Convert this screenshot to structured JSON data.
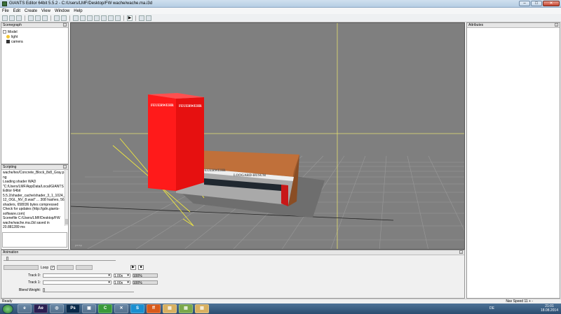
{
  "window": {
    "title": "GIANTS Editor 64bit 5.5.2 - C:/Users/LMF/Desktop/FW wache/wache.ma.i3d",
    "min": "–",
    "max": "□",
    "close": "✕"
  },
  "menu": [
    "File",
    "Edit",
    "Create",
    "View",
    "Window",
    "Help"
  ],
  "scenegraph": {
    "title": "Scenegraph",
    "nodes": [
      {
        "label": "Model",
        "icon": "expand-box"
      },
      {
        "label": "light",
        "icon": "bulb"
      },
      {
        "label": "camera",
        "icon": "camera"
      }
    ]
  },
  "scripting": {
    "title": "Scripting",
    "log": [
      "wache/tex/Concrete_Block_8x8_Gray.p",
      "ng",
      "Loading shader WAD",
      "\"C:/Users/LMF/AppData/Local/GIANTS",
      "Editor 64bit",
      "5.5.2/shader_cache/shader_3_1_1024_5",
      "12_OGL_NV_8.wad\" ... 308 hashes, 562",
      "shaders, 658036 bytes compressed",
      "Check for updates (http://gdn.giants-",
      "software.com)",
      "Scenefile C:/Users/LMF/Desktop/FW",
      "wache/wache.ma.i3d saved in",
      "20.881289 ms"
    ]
  },
  "viewport": {
    "camera_label": "persp",
    "building_tower_text": [
      "FEUERWEHR",
      "FEUERWEHR"
    ],
    "building_front_text": [
      "FREIWILLIGE FEUERWEHR",
      "LOOGARD-HUSUM"
    ]
  },
  "attributes": {
    "title": "Attributes"
  },
  "animation": {
    "title": "Animation",
    "loop_label": "Loop",
    "track0_label": "Track 0:",
    "track1_label": "Track 1:",
    "speed0": "1.00x",
    "speed1": "1.00x",
    "pct0": "100%",
    "pct1": "100%",
    "blend_label": "Blend Weight:"
  },
  "status": {
    "left": "Ready",
    "right": "Nav Speed 11 + -"
  },
  "taskbar": {
    "lang": "DE",
    "time": "21:01",
    "date": "18.08.2014",
    "apps": [
      {
        "name": "ie",
        "glyph": "e"
      },
      {
        "name": "ae",
        "glyph": "Ae"
      },
      {
        "name": "globe",
        "glyph": "◎"
      },
      {
        "name": "ps",
        "glyph": "Ps"
      },
      {
        "name": "media",
        "glyph": "▣"
      },
      {
        "name": "c",
        "glyph": "C"
      },
      {
        "name": "x",
        "glyph": "✕"
      },
      {
        "name": "skype",
        "glyph": "S"
      },
      {
        "name": "firefox",
        "glyph": "ff"
      },
      {
        "name": "folder1",
        "glyph": "▤"
      },
      {
        "name": "folder2",
        "glyph": "▤"
      },
      {
        "name": "folder3",
        "glyph": "▤"
      }
    ]
  },
  "colors": {
    "viewport_bg": "#7f7f7f",
    "tower": "#ff1a1a",
    "roof": "#c0703a",
    "taskbar": "#2c4d70"
  }
}
